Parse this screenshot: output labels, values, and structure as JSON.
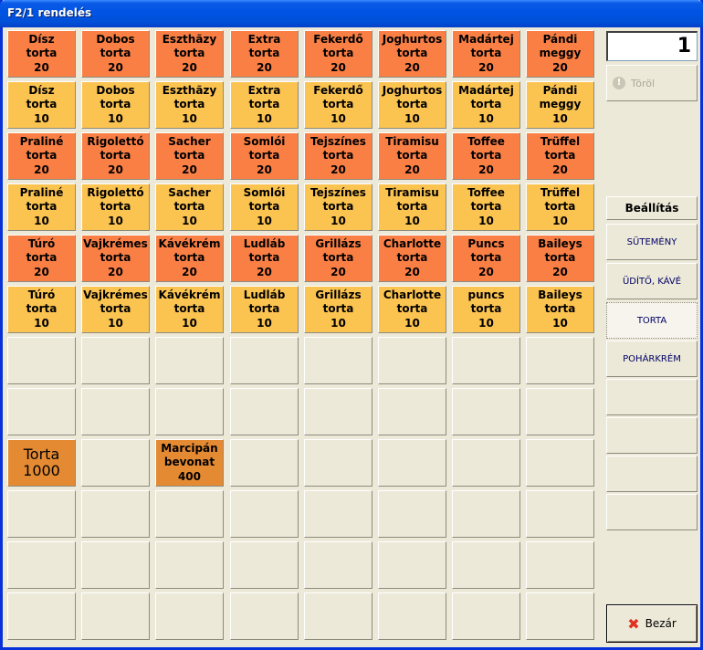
{
  "window": {
    "title": "F2/1 rendelés"
  },
  "rows": [
    [
      {
        "text": "Dísz\ntorta\n20",
        "c": "o20"
      },
      {
        "text": "Dobos\ntorta\n20",
        "c": "o20"
      },
      {
        "text": "Eszthãzy\ntorta\n20",
        "c": "o20"
      },
      {
        "text": "Extra\ntorta\n20",
        "c": "o20"
      },
      {
        "text": "Fekerdő\ntorta\n20",
        "c": "o20"
      },
      {
        "text": "Joghurtos\ntorta\n20",
        "c": "o20"
      },
      {
        "text": "Madártej\ntorta\n20",
        "c": "o20"
      },
      {
        "text": "Pándi\nmeggy\n20",
        "c": "o20"
      }
    ],
    [
      {
        "text": "Dísz\ntorta\n10",
        "c": "o10"
      },
      {
        "text": "Dobos\ntorta\n10",
        "c": "o10"
      },
      {
        "text": "Eszthãzy\ntorta\n10",
        "c": "o10"
      },
      {
        "text": "Extra\ntorta\n10",
        "c": "o10"
      },
      {
        "text": "Fekerdő\ntorta\n10",
        "c": "o10"
      },
      {
        "text": "Joghurtos\ntorta\n10",
        "c": "o10"
      },
      {
        "text": "Madártej\ntorta\n10",
        "c": "o10"
      },
      {
        "text": "Pándi\nmeggy\n10",
        "c": "o10"
      }
    ],
    [
      {
        "text": "Praliné\ntorta\n20",
        "c": "o20"
      },
      {
        "text": "Rigolettó\ntorta\n20",
        "c": "o20"
      },
      {
        "text": "Sacher\ntorta\n20",
        "c": "o20"
      },
      {
        "text": "Somlói\ntorta\n20",
        "c": "o20"
      },
      {
        "text": "Tejszínes\ntorta\n20",
        "c": "o20"
      },
      {
        "text": "Tiramisu\ntorta\n20",
        "c": "o20"
      },
      {
        "text": "Toffee\ntorta\n20",
        "c": "o20"
      },
      {
        "text": "Trüffel\ntorta\n20",
        "c": "o20"
      }
    ],
    [
      {
        "text": "Praliné\ntorta\n10",
        "c": "o10"
      },
      {
        "text": "Rigolettó\ntorta\n10",
        "c": "o10"
      },
      {
        "text": "Sacher\ntorta\n10",
        "c": "o10"
      },
      {
        "text": "Somlói\ntorta\n10",
        "c": "o10"
      },
      {
        "text": "Tejszínes\ntorta\n10",
        "c": "o10"
      },
      {
        "text": "Tiramisu\ntorta\n10",
        "c": "o10"
      },
      {
        "text": "Toffee\ntorta\n10",
        "c": "o10"
      },
      {
        "text": "Trüffel\ntorta\n10",
        "c": "o10"
      }
    ],
    [
      {
        "text": "Túró\ntorta\n20",
        "c": "o20"
      },
      {
        "text": "Vajkrémes\ntorta\n20",
        "c": "o20"
      },
      {
        "text": "Kávékrém\ntorta\n20",
        "c": "o20"
      },
      {
        "text": "Ludláb\ntorta\n20",
        "c": "o20"
      },
      {
        "text": "Grillázs\ntorta\n20",
        "c": "o20"
      },
      {
        "text": "Charlotte\ntorta\n20",
        "c": "o20"
      },
      {
        "text": "Puncs\ntorta\n20",
        "c": "o20"
      },
      {
        "text": "Baileys\ntorta\n20",
        "c": "o20"
      }
    ],
    [
      {
        "text": "Túró\ntorta\n10",
        "c": "o10"
      },
      {
        "text": "Vajkrémes\ntorta\n10",
        "c": "o10"
      },
      {
        "text": "Kávékrém\ntorta\n10",
        "c": "o10"
      },
      {
        "text": "Ludláb\ntorta\n10",
        "c": "o10"
      },
      {
        "text": "Grillázs\ntorta\n10",
        "c": "o10"
      },
      {
        "text": "Charlotte\ntorta\n10",
        "c": "o10"
      },
      {
        "text": "puncs\ntorta\n10",
        "c": "o10"
      },
      {
        "text": "Baileys\ntorta\n10",
        "c": "o10"
      }
    ],
    [
      {
        "text": "",
        "c": "empty"
      },
      {
        "text": "",
        "c": "empty"
      },
      {
        "text": "",
        "c": "empty"
      },
      {
        "text": "",
        "c": "empty"
      },
      {
        "text": "",
        "c": "empty"
      },
      {
        "text": "",
        "c": "empty"
      },
      {
        "text": "",
        "c": "empty"
      },
      {
        "text": "",
        "c": "empty"
      }
    ],
    [
      {
        "text": "",
        "c": "empty"
      },
      {
        "text": "",
        "c": "empty"
      },
      {
        "text": "",
        "c": "empty"
      },
      {
        "text": "",
        "c": "empty"
      },
      {
        "text": "",
        "c": "empty"
      },
      {
        "text": "",
        "c": "empty"
      },
      {
        "text": "",
        "c": "empty"
      },
      {
        "text": "",
        "c": "empty"
      }
    ],
    [
      {
        "text": "Torta\n1000",
        "c": "big"
      },
      {
        "text": "",
        "c": "empty"
      },
      {
        "text": "Marcipán\nbevonat\n400",
        "c": "marc"
      },
      {
        "text": "",
        "c": "empty"
      },
      {
        "text": "",
        "c": "empty"
      },
      {
        "text": "",
        "c": "empty"
      },
      {
        "text": "",
        "c": "empty"
      },
      {
        "text": "",
        "c": "empty"
      }
    ],
    [
      {
        "text": "",
        "c": "empty"
      },
      {
        "text": "",
        "c": "empty"
      },
      {
        "text": "",
        "c": "empty"
      },
      {
        "text": "",
        "c": "empty"
      },
      {
        "text": "",
        "c": "empty"
      },
      {
        "text": "",
        "c": "empty"
      },
      {
        "text": "",
        "c": "empty"
      },
      {
        "text": "",
        "c": "empty"
      }
    ],
    [
      {
        "text": "",
        "c": "empty"
      },
      {
        "text": "",
        "c": "empty"
      },
      {
        "text": "",
        "c": "empty"
      },
      {
        "text": "",
        "c": "empty"
      },
      {
        "text": "",
        "c": "empty"
      },
      {
        "text": "",
        "c": "empty"
      },
      {
        "text": "",
        "c": "empty"
      },
      {
        "text": "",
        "c": "empty"
      }
    ],
    [
      {
        "text": "",
        "c": "empty"
      },
      {
        "text": "",
        "c": "empty"
      },
      {
        "text": "",
        "c": "empty"
      },
      {
        "text": "",
        "c": "empty"
      },
      {
        "text": "",
        "c": "empty"
      },
      {
        "text": "",
        "c": "empty"
      },
      {
        "text": "",
        "c": "empty"
      },
      {
        "text": "",
        "c": "empty"
      }
    ]
  ],
  "side": {
    "quantity": "1",
    "delete_label": "Töröl",
    "delete_icon": "info-circle-icon",
    "settings_label": "Beállítás",
    "categories": [
      {
        "label": "SÜTEMÉNY",
        "active": false
      },
      {
        "label": "ÜDÍTŐ, KÁVÉ",
        "active": false
      },
      {
        "label": "TORTA",
        "active": true
      },
      {
        "label": "POHÁRKRÉM",
        "active": false
      },
      {
        "label": "",
        "active": false
      },
      {
        "label": "",
        "active": false
      },
      {
        "label": "",
        "active": false
      },
      {
        "label": "",
        "active": false
      }
    ],
    "close_label": "Bezár",
    "close_icon": "red-x-icon"
  },
  "colors": {
    "orange_20": "#fa7f45",
    "orange_10": "#fbc350",
    "special": "#e48a33",
    "titlebar": "#0054e3"
  }
}
